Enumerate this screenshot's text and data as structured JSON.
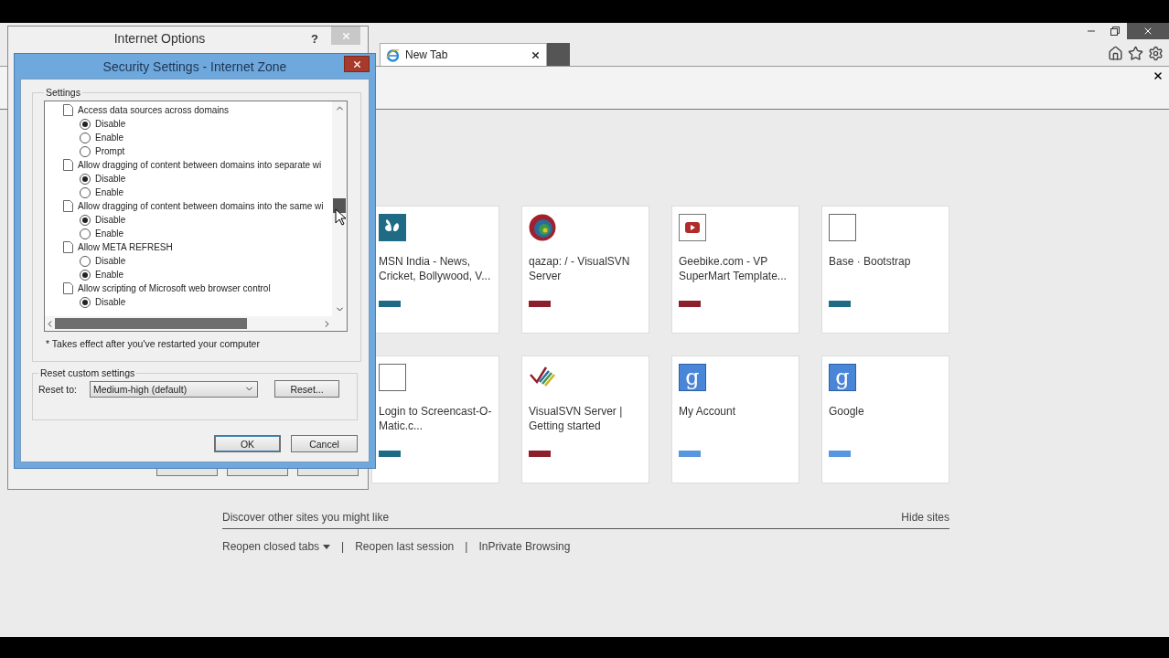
{
  "browser": {
    "tabs": [
      {
        "label": "New Tab",
        "selected": true
      }
    ],
    "tiles": [
      {
        "kind": "msn",
        "title": "MSN India - News, Cricket, Bollywood, V...",
        "color": "#1f6b85"
      },
      {
        "kind": "globe",
        "title": "qazap: / - VisualSVN Server",
        "color": "#8c1f2c"
      },
      {
        "kind": "video",
        "title": "Geebike.com - VP SuperMart Template...",
        "color": "#8c1f2c"
      },
      {
        "kind": "blank",
        "title": "Base · Bootstrap",
        "color": "#1f6b85"
      },
      {
        "kind": "blank",
        "title": "Login to Screencast-O-Matic.c...",
        "color": "#1f6b85"
      },
      {
        "kind": "ticks",
        "title": "VisualSVN Server | Getting started",
        "color": "#8c1f2c"
      },
      {
        "kind": "letter",
        "icon_text": "g",
        "title": "My Account",
        "color": "#5a95e0"
      },
      {
        "kind": "letter",
        "icon_text": "g",
        "title": "Google",
        "color": "#5a95e0"
      }
    ],
    "discover": "Discover other sites you might like",
    "hide_sites": "Hide sites",
    "links": [
      {
        "kind": "link",
        "label": "Reopen closed tabs",
        "dropdown": true
      },
      {
        "kind": "separator",
        "label": "|"
      },
      {
        "kind": "link",
        "label": "Reopen last session",
        "dropdown": false
      },
      {
        "kind": "separator",
        "label": "|"
      },
      {
        "kind": "link",
        "label": "InPrivate Browsing",
        "dropdown": false
      }
    ]
  },
  "internet_options": {
    "title": "Internet Options",
    "help": "?"
  },
  "security": {
    "title": "Security Settings - Internet Zone",
    "group": "Settings",
    "settings": [
      {
        "label": "Access data sources across domains",
        "children": [
          {
            "label": "Disable",
            "selected": true
          },
          {
            "label": "Enable",
            "selected": false
          },
          {
            "label": "Prompt",
            "selected": false
          }
        ]
      },
      {
        "label": "Allow dragging of content between domains into separate wi",
        "children": [
          {
            "label": "Disable",
            "selected": true
          },
          {
            "label": "Enable",
            "selected": false
          }
        ]
      },
      {
        "label": "Allow dragging of content between domains into the same wi",
        "children": [
          {
            "label": "Disable",
            "selected": true
          },
          {
            "label": "Enable",
            "selected": false
          }
        ]
      },
      {
        "label": "Allow META REFRESH",
        "children": [
          {
            "label": "Disable",
            "selected": false
          },
          {
            "label": "Enable",
            "selected": true
          }
        ]
      },
      {
        "label": "Allow scripting of Microsoft web browser control",
        "children": [
          {
            "label": "Disable",
            "selected": true
          }
        ]
      }
    ],
    "note": "* Takes effect after you've restarted your computer",
    "reset_group": "Reset custom settings",
    "reset_label": "Reset to:",
    "reset_value": "Medium-high (default)",
    "reset_button": "Reset...",
    "buttons": [
      "OK",
      "Cancel"
    ]
  }
}
